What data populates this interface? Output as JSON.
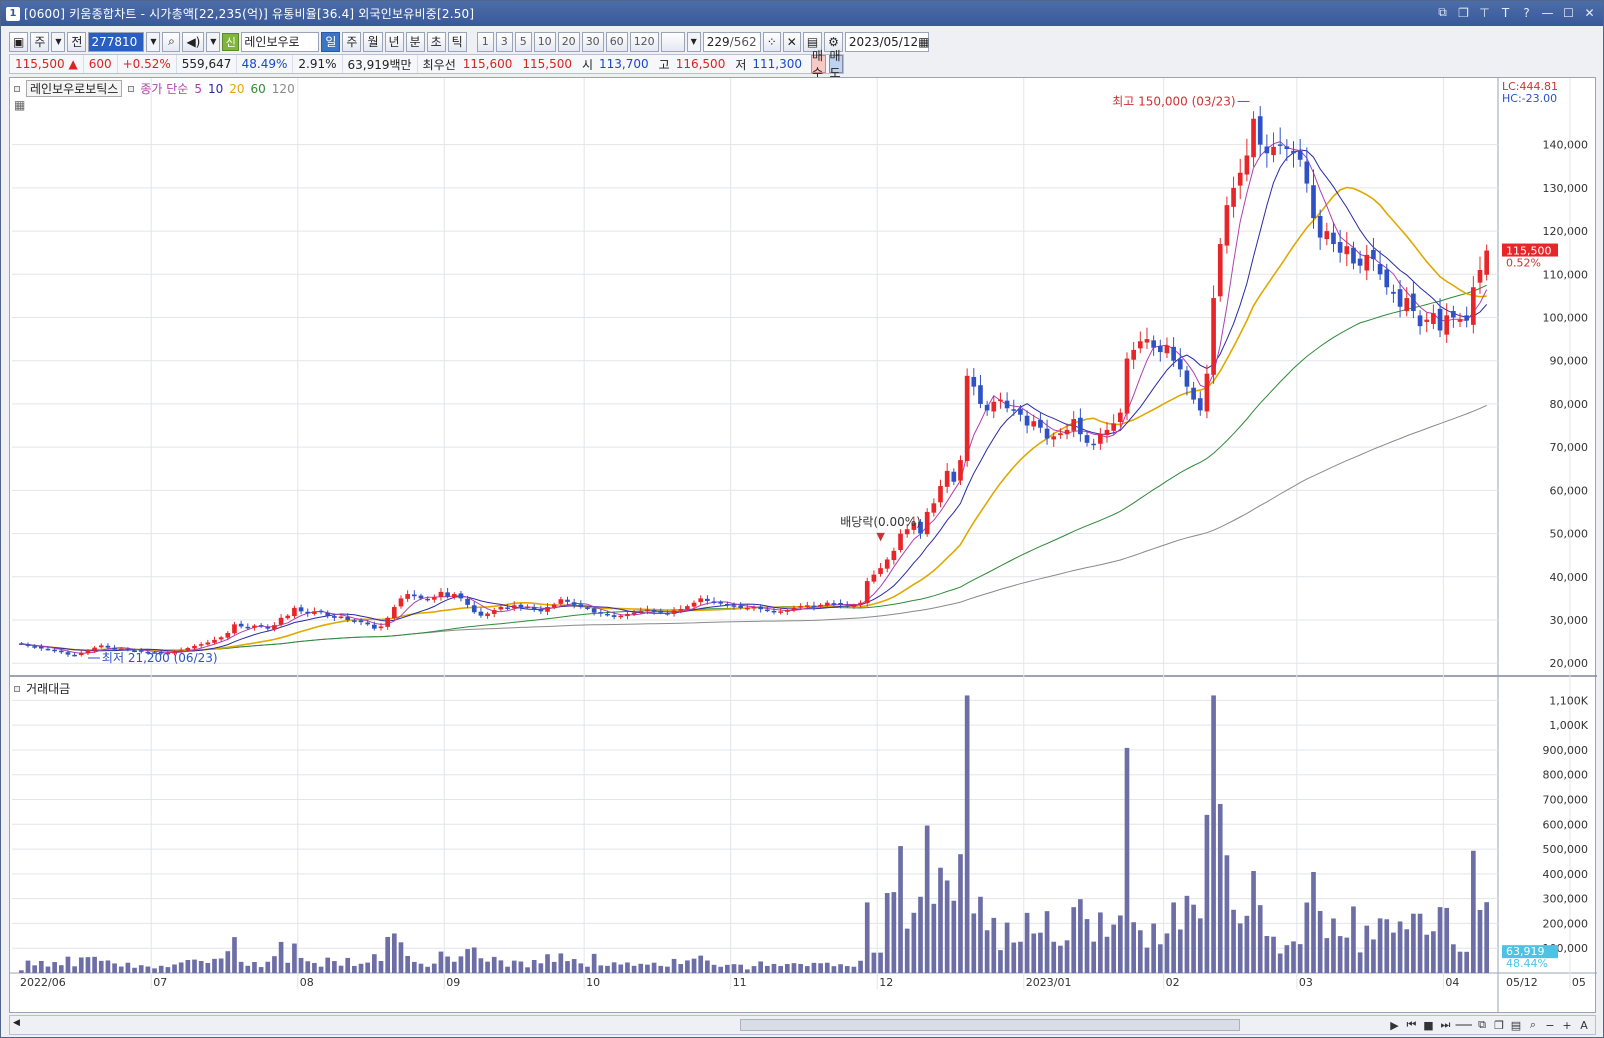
{
  "window": {
    "number": "1",
    "title": "[0600] 키움종합차트 - 시가총액[22,235(억)] 유통비율[36.4] 외국인보유비중[2.50]"
  },
  "toolbar": {
    "period_week": "주",
    "period_all": "전",
    "code": "277810",
    "shin": "신",
    "stock_name": "레인보우로",
    "tabs": [
      "일",
      "주",
      "월",
      "년",
      "분",
      "초",
      "틱"
    ],
    "intervals": [
      "1",
      "3",
      "5",
      "10",
      "20",
      "30",
      "60",
      "120"
    ],
    "count": "229",
    "count_total": "/562",
    "date": "2023/05/12"
  },
  "quote": {
    "price": "115,500",
    "change_arrow": "▲",
    "change": "600",
    "change_pct": "+0.52%",
    "volume": "559,647",
    "vol_ratio": "48.49%",
    "turnover": "2.91%",
    "amount": "63,919백만",
    "best_label": "최우선",
    "ask": "115,600",
    "bid": "115,500",
    "open_label": "시",
    "open": "113,700",
    "high_label": "고",
    "high": "116,500",
    "low_label": "저",
    "low": "111,300",
    "buy": "매수",
    "sell": "매도"
  },
  "legend": {
    "stock": "레인보우로보틱스",
    "ma_prefix": "종가 단순",
    "ma5": "5",
    "ma10": "10",
    "ma20": "20",
    "ma60": "60",
    "ma120": "120",
    "volume_title": "거래대금"
  },
  "colors": {
    "up": "#e8262a",
    "down": "#2e52c6",
    "ma5": "#b040b0",
    "ma10": "#2a2aa8",
    "ma20": "#e0a800",
    "ma60": "#2e8b3a",
    "ma120": "#8a8a8a",
    "volume_bar": "#6e6ea6"
  },
  "chart_data": {
    "type": "candlestick",
    "price_axis": [
      20000,
      30000,
      40000,
      50000,
      60000,
      70000,
      80000,
      90000,
      100000,
      110000,
      120000,
      130000,
      140000
    ],
    "price_tick_labels": [
      "20,000",
      "30,000",
      "40,000",
      "50,000",
      "60,000",
      "70,000",
      "80,000",
      "90,000",
      "100,000",
      "110,000",
      "120,000",
      "130,000",
      "140,000"
    ],
    "ylim": [
      17500,
      150800
    ],
    "x_tick_labels": [
      "2022/06",
      "07",
      "08",
      "09",
      "10",
      "11",
      "12",
      "2023/01",
      "02",
      "03",
      "04",
      "05",
      "05/12"
    ],
    "lc": "LC:444.81",
    "hc": "HC:-23.00",
    "current_price_label": "115,500",
    "current_pct_label": "0.52%",
    "annotations": {
      "high": "최고 150,000 (03/23)",
      "low": "최저 21,200 (06/23)",
      "dividend": "배당락(0.00%)"
    },
    "closes": [
      24500,
      24000,
      23800,
      23400,
      23200,
      22800,
      22600,
      22000,
      21800,
      22400,
      23000,
      23600,
      24100,
      23600,
      23300,
      23400,
      23000,
      22900,
      22700,
      22600,
      22500,
      22300,
      22400,
      22600,
      23000,
      23500,
      24000,
      24400,
      24800,
      25400,
      26000,
      27000,
      29000,
      28500,
      28300,
      28700,
      28500,
      28000,
      28800,
      30500,
      31000,
      32800,
      32000,
      31500,
      32000,
      31800,
      31000,
      30500,
      30800,
      30000,
      29800,
      29500,
      29000,
      28000,
      28500,
      30500,
      33000,
      35000,
      36000,
      35500,
      35000,
      34800,
      35200,
      36500,
      35400,
      36000,
      35000,
      33500,
      31800,
      31000,
      31500,
      32300,
      33000,
      32800,
      33400,
      32900,
      33100,
      32400,
      32000,
      33000,
      33600,
      34800,
      34200,
      33500,
      33000,
      32800,
      31700,
      31500,
      31200,
      30700,
      31000,
      31400,
      31700,
      32100,
      32400,
      32000,
      31700,
      31500,
      32200,
      32500,
      33200,
      34000,
      35000,
      34400,
      34000,
      33800,
      33500,
      33200,
      32800,
      32800,
      33000,
      32500,
      32200,
      31800,
      32000,
      32300,
      32800,
      33200,
      33400,
      33000,
      33500,
      34000,
      33800,
      33500,
      33200,
      33400,
      34000,
      39000,
      40500,
      42000,
      44000,
      46000,
      50000,
      51000,
      52500,
      50000,
      55000,
      57000,
      61000,
      64500,
      62000,
      67000,
      86500,
      84000,
      80000,
      78500,
      80500,
      81000,
      79000,
      78500,
      77500,
      75000,
      76000,
      74500,
      72000,
      72500,
      73200,
      74000,
      76500,
      73000,
      71000,
      70500,
      73000,
      74000,
      75500,
      78000,
      90500,
      92500,
      94500,
      95000,
      93000,
      92000,
      93500,
      90000,
      88000,
      84000,
      81000,
      78500,
      87000,
      104500,
      117000,
      126000,
      130000,
      133500,
      137500,
      146000,
      140000,
      138000,
      139500,
      140000,
      139000,
      138000,
      136500,
      131000,
      123000,
      118500,
      120000,
      117000,
      115000,
      116500,
      112500,
      112000,
      114500,
      113500,
      110000,
      107000,
      105500,
      102500,
      104500,
      101500,
      98000,
      99500,
      101000,
      97000,
      100500,
      100000,
      99500,
      99300,
      107000,
      111000,
      115500
    ]
  },
  "volume_axis": [
    "100,000",
    "200,000",
    "300,000",
    "400,000",
    "500,000",
    "600,000",
    "700,000",
    "800,000",
    "900,000",
    "1,000K",
    "1,100K"
  ],
  "volume_current": "63,919",
  "volume_pct": "48.44%"
}
